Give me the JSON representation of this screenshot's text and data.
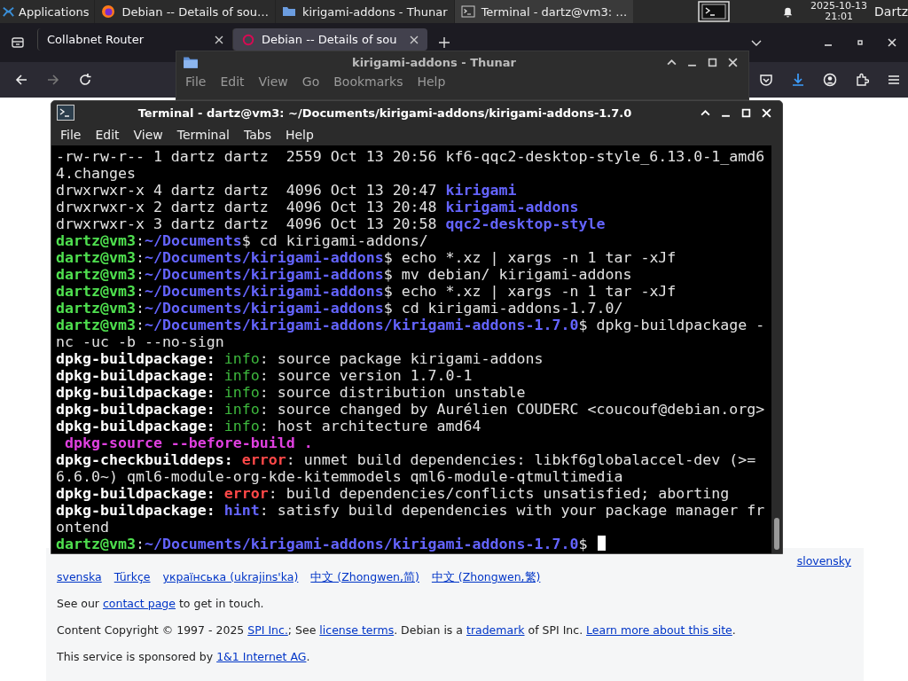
{
  "taskbar": {
    "apps_menu": "Applications",
    "tasks": [
      {
        "title": "Debian -- Details of sou…",
        "kind": "browser",
        "selected": false
      },
      {
        "title": "kirigami-addons - Thunar",
        "kind": "folder",
        "selected": false
      },
      {
        "title": "Terminal - dartz@vm3: …",
        "kind": "terminal",
        "selected": true
      }
    ],
    "clock": {
      "date": "2025-10-13",
      "time": "21:01"
    },
    "user": "Dartz"
  },
  "browser": {
    "tabs": [
      {
        "title": "Collabnet Router",
        "selected": false
      },
      {
        "title": "Debian -- Details of sou",
        "selected": true
      }
    ],
    "page": {
      "languages_row_1": [
        "slovensky"
      ],
      "languages_row_2": [
        "svenska",
        "Türkçe",
        "українська (ukrajins'ka)",
        "中文 (Zhongwen,简)",
        "中文 (Zhongwen,繁)"
      ],
      "paragraphs": [
        [
          {
            "text": "See our "
          },
          {
            "text": "contact page",
            "link": true
          },
          {
            "text": " to get in touch."
          }
        ],
        [
          {
            "text": "Content Copyright © 1997 - 2025 "
          },
          {
            "text": "SPI Inc.",
            "link": true
          },
          {
            "text": "; See "
          },
          {
            "text": "license terms",
            "link": true
          },
          {
            "text": ". Debian is a "
          },
          {
            "text": "trademark",
            "link": true
          },
          {
            "text": " of SPI Inc. "
          },
          {
            "text": "Learn more about this site",
            "link": true
          },
          {
            "text": "."
          }
        ],
        [
          {
            "text": "This service is sponsored by "
          },
          {
            "text": "1&1 Internet AG",
            "link": true
          },
          {
            "text": "."
          }
        ]
      ]
    }
  },
  "thunar": {
    "title": "kirigami-addons - Thunar",
    "menu": [
      "File",
      "Edit",
      "View",
      "Go",
      "Bookmarks",
      "Help"
    ]
  },
  "terminal": {
    "title": "Terminal - dartz@vm3: ~/Documents/kirigami-addons/kirigami-addons-1.7.0",
    "menu": [
      "File",
      "Edit",
      "View",
      "Terminal",
      "Tabs",
      "Help"
    ],
    "cursor_visible": true,
    "lines": [
      [
        {
          "text": "-rw-rw-r-- 1 dartz dartz  2559 Oct 13 20:56 kf6-qqc2-desktop-style_6.13.0-1_amd6",
          "kind": "plain"
        }
      ],
      [
        {
          "text": "4.changes",
          "kind": "plain"
        }
      ],
      [
        {
          "text": "drwxrwxr-x 4 dartz dartz  4096 Oct 13 20:47 ",
          "kind": "plain"
        },
        {
          "text": "kirigami",
          "kind": "dir"
        }
      ],
      [
        {
          "text": "drwxrwxr-x 2 dartz dartz  4096 Oct 13 20:48 ",
          "kind": "plain"
        },
        {
          "text": "kirigami-addons",
          "kind": "dir"
        }
      ],
      [
        {
          "text": "drwxrwxr-x 3 dartz dartz  4096 Oct 13 20:58 ",
          "kind": "plain"
        },
        {
          "text": "qqc2-desktop-style",
          "kind": "dir"
        }
      ],
      [
        {
          "text": "dartz@vm3",
          "kind": "user"
        },
        {
          "text": ":",
          "kind": "plain"
        },
        {
          "text": "~/Documents",
          "kind": "path"
        },
        {
          "text": "$ cd kirigami-addons/",
          "kind": "plain"
        }
      ],
      [
        {
          "text": "dartz@vm3",
          "kind": "user"
        },
        {
          "text": ":",
          "kind": "plain"
        },
        {
          "text": "~/Documents/kirigami-addons",
          "kind": "path"
        },
        {
          "text": "$ echo *.xz | xargs -n 1 tar -xJf",
          "kind": "plain"
        }
      ],
      [
        {
          "text": "dartz@vm3",
          "kind": "user"
        },
        {
          "text": ":",
          "kind": "plain"
        },
        {
          "text": "~/Documents/kirigami-addons",
          "kind": "path"
        },
        {
          "text": "$ mv debian/ kirigami-addons",
          "kind": "plain"
        }
      ],
      [
        {
          "text": "dartz@vm3",
          "kind": "user"
        },
        {
          "text": ":",
          "kind": "plain"
        },
        {
          "text": "~/Documents/kirigami-addons",
          "kind": "path"
        },
        {
          "text": "$ echo *.xz | xargs -n 1 tar -xJf",
          "kind": "plain"
        }
      ],
      [
        {
          "text": "dartz@vm3",
          "kind": "user"
        },
        {
          "text": ":",
          "kind": "plain"
        },
        {
          "text": "~/Documents/kirigami-addons",
          "kind": "path"
        },
        {
          "text": "$ cd kirigami-addons-1.7.0/",
          "kind": "plain"
        }
      ],
      [
        {
          "text": "dartz@vm3",
          "kind": "user"
        },
        {
          "text": ":",
          "kind": "plain"
        },
        {
          "text": "~/Documents/kirigami-addons/kirigami-addons-1.7.0",
          "kind": "path"
        },
        {
          "text": "$ dpkg-buildpackage -",
          "kind": "plain"
        }
      ],
      [
        {
          "text": "nc -uc -b --no-sign",
          "kind": "plain"
        }
      ],
      [
        {
          "text": "dpkg-buildpackage: ",
          "kind": "bold"
        },
        {
          "text": "info",
          "kind": "info"
        },
        {
          "text": ": source package kirigami-addons",
          "kind": "plain"
        }
      ],
      [
        {
          "text": "dpkg-buildpackage: ",
          "kind": "bold"
        },
        {
          "text": "info",
          "kind": "info"
        },
        {
          "text": ": source version 1.7.0-1",
          "kind": "plain"
        }
      ],
      [
        {
          "text": "dpkg-buildpackage: ",
          "kind": "bold"
        },
        {
          "text": "info",
          "kind": "info"
        },
        {
          "text": ": source distribution unstable",
          "kind": "plain"
        }
      ],
      [
        {
          "text": "dpkg-buildpackage: ",
          "kind": "bold"
        },
        {
          "text": "info",
          "kind": "info"
        },
        {
          "text": ": source changed by Aurélien COUDERC <coucouf@debian.org>",
          "kind": "plain"
        }
      ],
      [
        {
          "text": "dpkg-buildpackage: ",
          "kind": "bold"
        },
        {
          "text": "info",
          "kind": "info"
        },
        {
          "text": ": host architecture amd64",
          "kind": "plain"
        }
      ],
      [
        {
          "text": " dpkg-source --before-build .",
          "kind": "section"
        }
      ],
      [
        {
          "text": "dpkg-checkbuilddeps: ",
          "kind": "bold"
        },
        {
          "text": "error",
          "kind": "error"
        },
        {
          "text": ": unmet build dependencies: libkf6globalaccel-dev (>=",
          "kind": "plain"
        }
      ],
      [
        {
          "text": "6.6.0~) qml6-module-org-kde-kitemmodels qml6-module-qtmultimedia",
          "kind": "plain"
        }
      ],
      [
        {
          "text": "dpkg-buildpackage: ",
          "kind": "bold"
        },
        {
          "text": "error",
          "kind": "error"
        },
        {
          "text": ": build dependencies/conflicts unsatisfied; aborting",
          "kind": "plain"
        }
      ],
      [
        {
          "text": "dpkg-buildpackage: ",
          "kind": "bold"
        },
        {
          "text": "hint",
          "kind": "hint"
        },
        {
          "text": ": satisfy build dependencies with your package manager fr",
          "kind": "plain"
        }
      ],
      [
        {
          "text": "ontend",
          "kind": "plain"
        }
      ],
      [
        {
          "text": "dartz@vm3",
          "kind": "user"
        },
        {
          "text": ":",
          "kind": "plain"
        },
        {
          "text": "~/Documents/kirigami-addons/kirigami-addons-1.7.0",
          "kind": "path"
        },
        {
          "text": "$ ",
          "kind": "plain"
        }
      ]
    ]
  }
}
